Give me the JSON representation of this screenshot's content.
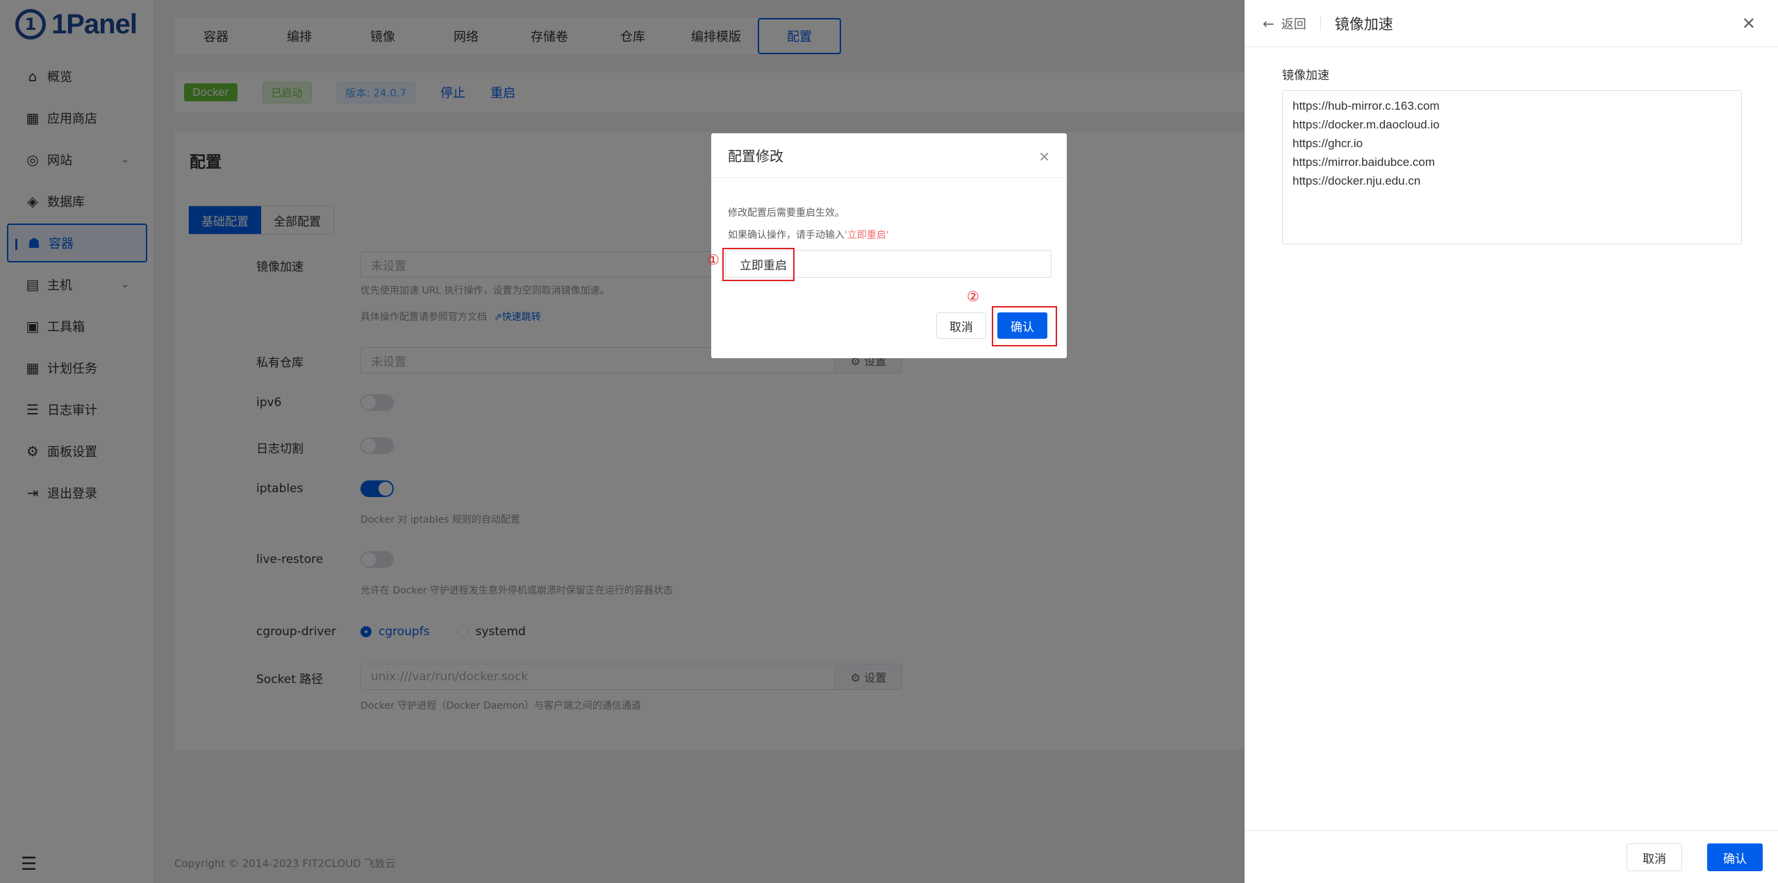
{
  "app": {
    "logo_text": "1Panel",
    "logo_letter": "1"
  },
  "sidebar": {
    "items": [
      {
        "label": "概览",
        "icon": "home-icon"
      },
      {
        "label": "应用商店",
        "icon": "grid-icon"
      },
      {
        "label": "网站",
        "icon": "globe-icon",
        "has_children": true
      },
      {
        "label": "数据库",
        "icon": "layers-icon"
      },
      {
        "label": "容器",
        "icon": "docker-icon",
        "active": true
      },
      {
        "label": "主机",
        "icon": "server-icon",
        "has_children": true
      },
      {
        "label": "工具箱",
        "icon": "toolbox-icon"
      },
      {
        "label": "计划任务",
        "icon": "calendar-icon"
      },
      {
        "label": "日志审计",
        "icon": "log-icon"
      },
      {
        "label": "面板设置",
        "icon": "gear-icon"
      },
      {
        "label": "退出登录",
        "icon": "logout-icon"
      }
    ],
    "footer_icon": "menu-fold-icon"
  },
  "top_tabs": [
    {
      "label": "容器"
    },
    {
      "label": "编排"
    },
    {
      "label": "镜像"
    },
    {
      "label": "网络"
    },
    {
      "label": "存储卷"
    },
    {
      "label": "仓库"
    },
    {
      "label": "编排模版"
    },
    {
      "label": "配置",
      "active": true
    }
  ],
  "status": {
    "docker_badge": "Docker",
    "running_badge": "已启动",
    "version_badge": "版本: 24.0.7",
    "stop_label": "停止",
    "restart_label": "重启"
  },
  "config": {
    "title": "配置",
    "tabs": {
      "basic": "基础配置",
      "all": "全部配置"
    },
    "mirror": {
      "label": "镜像加速",
      "placeholder": "未设置",
      "help1": "优先使用加速 URL 执行操作，设置为空则取消镜像加速。",
      "help2": "具体操作配置请参照官方文档",
      "help_link": "⇗快速跳转"
    },
    "registry": {
      "label": "私有仓库",
      "placeholder": "未设置",
      "append": "⚙ 设置"
    },
    "ipv6": {
      "label": "ipv6"
    },
    "log_cut": {
      "label": "日志切割"
    },
    "iptables": {
      "label": "iptables",
      "help": "Docker 对 iptables 规则的自动配置"
    },
    "live_restore": {
      "label": "live-restore",
      "help": "允许在 Docker 守护进程发生意外停机或崩溃时保留正在运行的容器状态"
    },
    "cgroup": {
      "label": "cgroup-driver",
      "opt1": "cgroupfs",
      "opt2": "systemd"
    },
    "socket": {
      "label": "Socket 路径",
      "value": "unix:///var/run/docker.sock",
      "append": "⚙ 设置",
      "help": "Docker 守护进程（Docker Daemon）与客户端之间的通信通道"
    }
  },
  "footer": {
    "copyright": "Copyright © 2014-2023 FIT2CLOUD 飞致云"
  },
  "drawer": {
    "back_label": "返回",
    "title": "镜像加速",
    "field_label": "镜像加速",
    "mirrors_text": "https://hub-mirror.c.163.com\nhttps://docker.m.daocloud.io\nhttps://ghcr.io\nhttps://mirror.baidubce.com\nhttps://docker.nju.edu.cn",
    "cancel_label": "取消",
    "confirm_label": "确认"
  },
  "dialog": {
    "title": "配置修改",
    "line1": "修改配置后需要重启生效。",
    "line2_prefix": "如果确认操作，请手动输入",
    "line2_highlight": "'立即重启'",
    "input_value": "立即重启",
    "cancel_label": "取消",
    "confirm_label": "确认",
    "marker1": "①",
    "marker2": "②"
  }
}
